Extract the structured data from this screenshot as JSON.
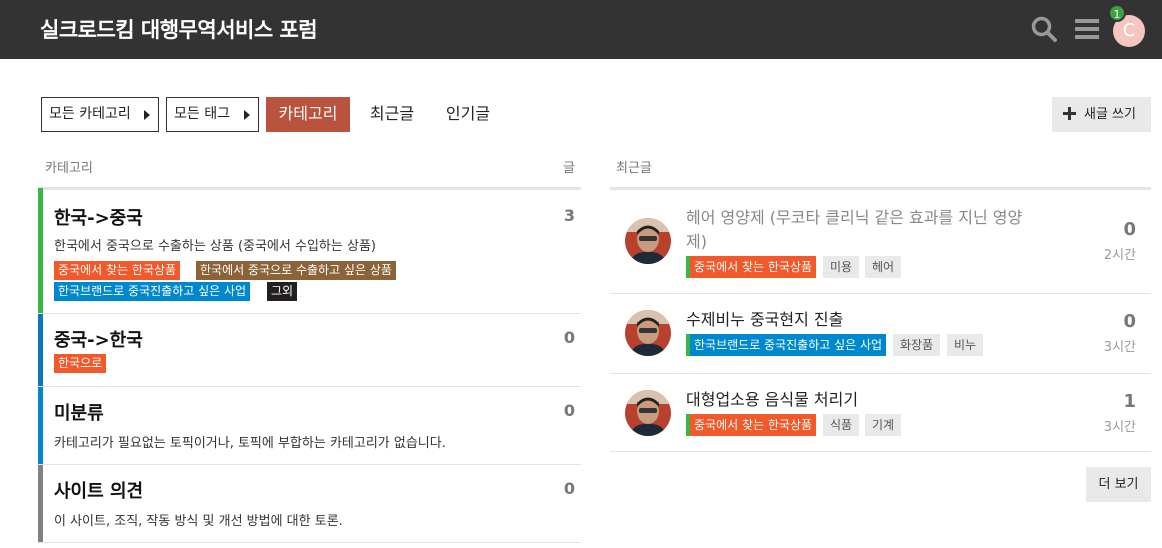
{
  "header": {
    "title": "실크로드킴 대행무역서비스 포럼",
    "notification_count": "1",
    "avatar_letter": "C",
    "search_icon": "search-icon",
    "menu_icon": "hamburger-icon"
  },
  "nav": {
    "all_categories": "모든 카테고리",
    "all_tags": "모든 태그",
    "tabs": [
      "카테고리",
      "최근글",
      "인기글"
    ],
    "active_tab": "카테고리",
    "new_topic": "새글 쓰기"
  },
  "categories_panel": {
    "header": "카테고리",
    "count_header": "글",
    "items": [
      {
        "name": "한국->중국",
        "description": "한국에서 중국으로 수출하는 상품 (중국에서 수입하는 상품)",
        "count": "3",
        "color": "#3ab54a",
        "subcategories": [
          {
            "label": "중국에서 찾는 한국상품",
            "color": "#f1592a"
          },
          {
            "label": "한국에서 중국으로 수출하고 싶은 상품",
            "color": "#8c6238"
          },
          {
            "label": "한국브랜드로 중국진출하고 싶은 사업",
            "color": "#0088cc"
          },
          {
            "label": "그외",
            "color": "#231f20"
          }
        ]
      },
      {
        "name": "중국->한국",
        "description": "",
        "count": "0",
        "color": "#0e76bd",
        "subcategories": [
          {
            "label": "한국으로",
            "color": "#f1592a"
          }
        ]
      },
      {
        "name": "미분류",
        "description": "카테고리가 필요없는 토픽이거나, 토픽에 부합하는 카테고리가 없습니다.",
        "count": "0",
        "color": "#0088cc",
        "subcategories": []
      },
      {
        "name": "사이트 의견",
        "description": "이 사이트, 조직, 작동 방식 및 개선 방법에 대한 토론.",
        "count": "0",
        "color": "#808281",
        "subcategories": []
      }
    ]
  },
  "latest_panel": {
    "header": "최근글",
    "topics": [
      {
        "title": "헤어 영양제 (무코타 클리닉 같은 효과를 지닌 영양제)",
        "category": "중국에서 찾는 한국상품",
        "category_color": "#f1592a",
        "parent_color": "#3ab54a",
        "tags": [
          "미용",
          "헤어"
        ],
        "replies": "0",
        "age": "2시간"
      },
      {
        "title": "수제비누 중국현지 진출",
        "category": "한국브랜드로 중국진출하고 싶은 사업",
        "category_color": "#0088cc",
        "parent_color": "#3ab54a",
        "tags": [
          "화장품",
          "비누"
        ],
        "replies": "0",
        "age": "3시간"
      },
      {
        "title": "대형업소용 음식물 처리기",
        "category": "중국에서 찾는 한국상품",
        "category_color": "#f1592a",
        "parent_color": "#3ab54a",
        "tags": [
          "식품",
          "기계"
        ],
        "replies": "1",
        "age": "3시간"
      }
    ],
    "more_button": "더 보기"
  }
}
